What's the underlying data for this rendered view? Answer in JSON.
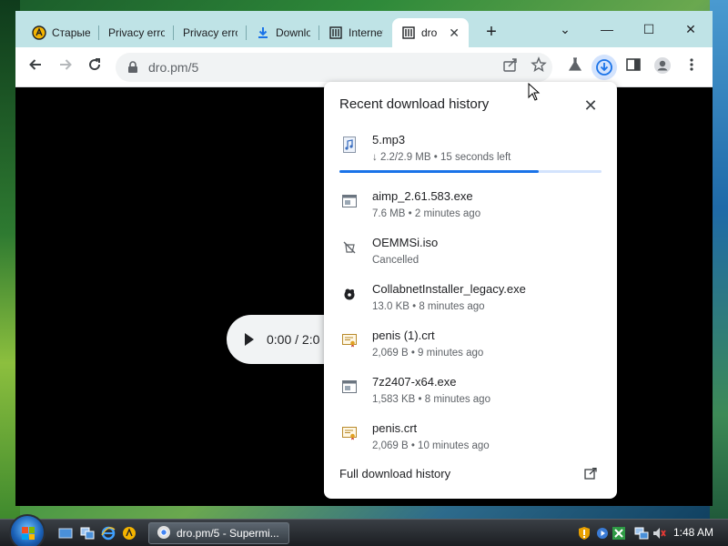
{
  "tabs": [
    {
      "label": "Старые",
      "icon": "aimp-icon"
    },
    {
      "label": "Privacy error",
      "icon": "warning-icon"
    },
    {
      "label": "Privacy error",
      "icon": "warning-icon"
    },
    {
      "label": "Downlo",
      "icon": "download-icon"
    },
    {
      "label": "Internet",
      "icon": "archive-icon"
    },
    {
      "label": "dro",
      "icon": "archive-icon"
    }
  ],
  "new_tab": "+",
  "window_controls": {
    "chevron": "⌄",
    "minimize": "—",
    "maximize": "☐",
    "close": "✕"
  },
  "omnibox": {
    "url": "dro.pm/5"
  },
  "player": {
    "time": "0:00 / 2:0"
  },
  "downloads": {
    "title": "Recent download history",
    "close": "✕",
    "items": [
      {
        "name": "5.mp3",
        "status": "↓ 2.2/2.9 MB • 15 seconds left",
        "icon": "music-file-icon",
        "progress_pct": 75.9
      },
      {
        "name": "aimp_2.61.583.exe",
        "status": "7.6 MB • 2 minutes ago",
        "icon": "exe-file-icon"
      },
      {
        "name": "OEMMSi.iso",
        "status": "Cancelled",
        "icon": "cancelled-file-icon"
      },
      {
        "name": "CollabnetInstaller_legacy.exe",
        "status": "13.0 KB • 8 minutes ago",
        "icon": "installer-file-icon"
      },
      {
        "name": "penis (1).crt",
        "status": "2,069 B • 9 minutes ago",
        "icon": "certificate-file-icon"
      },
      {
        "name": "7z2407-x64.exe",
        "status": "1,583 KB • 8 minutes ago",
        "icon": "exe-file-icon"
      },
      {
        "name": "penis.crt",
        "status": "2,069 B • 10 minutes ago",
        "icon": "certificate-file-icon"
      }
    ],
    "full_history": "Full download history"
  },
  "taskbar": {
    "task_label": "dro.pm/5 - Supermi...",
    "clock": "1:48 AM"
  },
  "colors": {
    "accent": "#1a73e8",
    "titlebar": "#bfe3e6",
    "download_highlight": "#d3e3fd"
  }
}
